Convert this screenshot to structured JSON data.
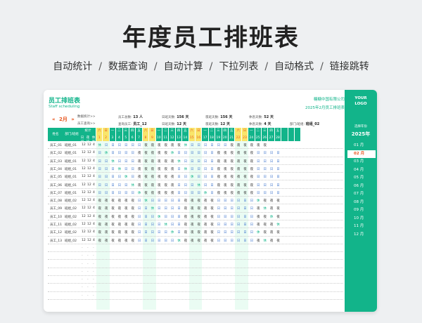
{
  "hero": {
    "title": "年度员工排班表",
    "features": [
      "自动统计",
      "数据查询",
      "自动计算",
      "下拉列表",
      "自动格式",
      "链接跳转"
    ],
    "separator": "/"
  },
  "sheet": {
    "title": "员工排班表",
    "subtitle": "Staff scheduling",
    "company": "糖糖中国有限公司",
    "period": "2025年2月员工排班表",
    "month_nav": {
      "prev": "«",
      "label": "2月",
      "next": "»"
    }
  },
  "info": {
    "line1": [
      {
        "label": "数据统计>>",
        "value": ""
      },
      {
        "label": "员工总数:",
        "value": "13 人"
      },
      {
        "label": "日班天数:",
        "value": "156 天"
      },
      {
        "label": "夜班天数:",
        "value": "156 天"
      },
      {
        "label": "休息天数:",
        "value": "52 天"
      }
    ],
    "line2": [
      {
        "label": "员工查询>>",
        "value": ""
      },
      {
        "label": "查询员工:",
        "value": "员工_12"
      },
      {
        "label": "日班天数:",
        "value": "12 天"
      },
      {
        "label": "夜班天数:",
        "value": "12 天"
      },
      {
        "label": "休息天数:",
        "value": "4 天"
      },
      {
        "label": "部门/班组:",
        "value": "班组_02"
      }
    ]
  },
  "table": {
    "headers": {
      "name": "姓名",
      "dept": "部门/班组",
      "stats": "统计",
      "day": "日班",
      "night": "夜班",
      "rest": "休息"
    },
    "weekdays": [
      "六",
      "日",
      "一",
      "二",
      "三",
      "四",
      "五",
      "六",
      "日",
      "一",
      "二",
      "三",
      "四",
      "五",
      "六",
      "日",
      "一",
      "二",
      "三",
      "四",
      "五",
      "六",
      "日",
      "一",
      "二",
      "三",
      "四",
      "五"
    ],
    "days": [
      "1",
      "2",
      "3",
      "4",
      "5",
      "6",
      "7",
      "8",
      "9",
      "10",
      "11",
      "12",
      "13",
      "14",
      "15",
      "16",
      "17",
      "18",
      "19",
      "20",
      "21",
      "22",
      "23",
      "24",
      "25",
      "26",
      "27",
      "28"
    ],
    "weekend_flags": [
      1,
      1,
      0,
      0,
      0,
      0,
      0,
      1,
      1,
      0,
      0,
      0,
      0,
      0,
      1,
      1,
      0,
      0,
      0,
      0,
      0,
      1,
      1,
      0,
      0,
      0,
      0,
      0
    ],
    "rows": [
      {
        "name": "员工_01",
        "dept": "班组_01",
        "day": "12",
        "night": "12",
        "rest": "4",
        "shifts": "休日日日日日日夜夜夜夜夜夜休日日日日日日夜夜夜夜夜夜"
      },
      {
        "name": "员工_02",
        "dept": "班组_01",
        "day": "12",
        "night": "12",
        "rest": "4",
        "shifts": "日休日日日日夜夜夜夜夜休日日日日日日夜夜夜夜夜夜日日日日"
      },
      {
        "name": "员工_03",
        "dept": "班组_01",
        "day": "12",
        "night": "12",
        "rest": "4",
        "shifts": "日日休日日日夜夜夜夜夜夜休日日日日日夜夜夜夜夜夜日日日日"
      },
      {
        "name": "员工_04",
        "dept": "班组_01",
        "day": "12",
        "night": "12",
        "rest": "4",
        "shifts": "日日日休日日夜夜夜夜夜夜日休日日日日夜夜夜夜夜夜日日日日"
      },
      {
        "name": "员工_05",
        "dept": "班组_01",
        "day": "12",
        "night": "12",
        "rest": "4",
        "shifts": "日日日日休日夜夜夜夜夜夜日日休日日日夜夜夜夜夜夜日日日日"
      },
      {
        "name": "员工_06",
        "dept": "班组_01",
        "day": "12",
        "night": "12",
        "rest": "4",
        "shifts": "日日日日日休夜夜夜夜夜夜日日日休日日夜夜夜夜夜夜日日日日"
      },
      {
        "name": "员工_07",
        "dept": "班组_01",
        "day": "12",
        "night": "12",
        "rest": "4",
        "shifts": "日日日日日日休夜夜夜夜夜日日日日休日夜夜夜夜夜夜日日日日"
      },
      {
        "name": "员工_08",
        "dept": "班组_02",
        "day": "12",
        "night": "12",
        "rest": "4",
        "shifts": "夜夜夜夜夜夜日休日日日日日夜夜夜夜夜日日日日日日休夜夜夜"
      },
      {
        "name": "员工_09",
        "dept": "班组_02",
        "day": "12",
        "night": "12",
        "rest": "4",
        "shifts": "夜夜夜夜夜夜日日休日日日日夜夜夜夜夜日日日日日日夜休夜夜"
      },
      {
        "name": "员工_10",
        "dept": "班组_02",
        "day": "12",
        "night": "12",
        "rest": "4",
        "shifts": "夜夜夜夜夜夜日日日休日日日夜夜夜夜夜日日日日日日夜夜休夜"
      },
      {
        "name": "员工_11",
        "dept": "班组_02",
        "day": "12",
        "night": "12",
        "rest": "4",
        "shifts": "夜夜夜夜夜夜日日日日休日日夜夜夜夜夜日日日日日日夜夜夜休"
      },
      {
        "name": "员工_12",
        "dept": "班组_02",
        "day": "12",
        "night": "12",
        "rest": "4",
        "shifts": "夜夜夜夜夜夜日日日日日休日夜夜夜夜夜日日日日日日休夜夜夜"
      },
      {
        "name": "员工_13",
        "dept": "班组_02",
        "day": "12",
        "night": "12",
        "rest": "4",
        "shifts": "夜夜夜夜夜夜日日日日日日休夜夜夜夜夜日日日日日日夜休夜夜"
      }
    ],
    "empty_rows": 7,
    "empty_mark": "-"
  },
  "sidebar": {
    "logo_line1": "YOUR",
    "logo_line2": "LOGO",
    "label": "选择年份",
    "year": "2025年",
    "months": [
      "01 月",
      "02 月",
      "03 月",
      "04 月",
      "05 月",
      "06 月",
      "07 月",
      "08 月",
      "09 月",
      "10 月",
      "11 月",
      "12 月"
    ],
    "active_month_index": 1
  },
  "colors": {
    "accent": "#12b48a",
    "weekend": "#f9e56a",
    "highlight": "#e8551e"
  }
}
